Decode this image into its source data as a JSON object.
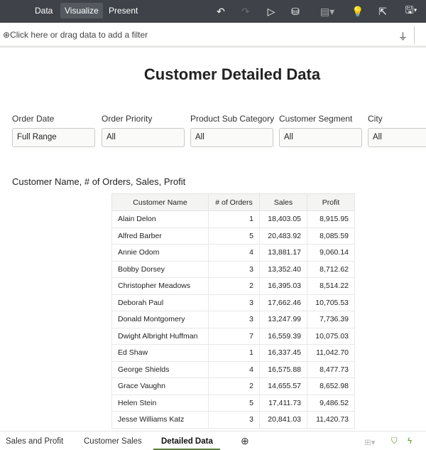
{
  "toolbar": {
    "tabs": [
      "Data",
      "Visualize",
      "Present"
    ],
    "active_tab": "Visualize"
  },
  "filter_bar": {
    "placeholder": "Click here or drag data to add a filter"
  },
  "page_title": "Customer Detailed Data",
  "filters": [
    {
      "label": "Order Date",
      "value": "Full Range"
    },
    {
      "label": "Order Priority",
      "value": "All"
    },
    {
      "label": "Product Sub Category",
      "value": "All"
    },
    {
      "label": "Customer Segment",
      "value": "All"
    },
    {
      "label": "City",
      "value": "All"
    }
  ],
  "table": {
    "title": "Customer Name, # of Orders, Sales, Profit",
    "columns": [
      "Customer Name",
      "# of Orders",
      "Sales",
      "Profit"
    ],
    "rows": [
      [
        "Alain Delon",
        "1",
        "18,403.05",
        "8,915.95"
      ],
      [
        "Alfred Barber",
        "5",
        "20,483.92",
        "8,085.59"
      ],
      [
        "Annie Odom",
        "4",
        "13,881.17",
        "9,060.14"
      ],
      [
        "Bobby Dorsey",
        "3",
        "13,352.40",
        "8,712.62"
      ],
      [
        "Christopher Meadows",
        "2",
        "16,395.03",
        "8,514.22"
      ],
      [
        "Deborah Paul",
        "3",
        "17,662.46",
        "10,705.53"
      ],
      [
        "Donald Montgomery",
        "3",
        "13,247.99",
        "7,736.39"
      ],
      [
        "Dwight Albright Huffman",
        "7",
        "16,559.39",
        "10,075.03"
      ],
      [
        "Ed Shaw",
        "1",
        "16,337.45",
        "11,042.70"
      ],
      [
        "George Shields",
        "4",
        "16,575.88",
        "8,477.73"
      ],
      [
        "Grace Vaughn",
        "2",
        "14,655.57",
        "8,652.98"
      ],
      [
        "Helen Stein",
        "5",
        "17,411.73",
        "9,486.52"
      ],
      [
        "Jesse Williams Katz",
        "3",
        "20,841.03",
        "11,420.73"
      ]
    ]
  },
  "canvas_tabs": [
    "Sales and Profit",
    "Customer Sales",
    "Detailed Data"
  ],
  "active_canvas": "Detailed Data",
  "colors": {
    "toolbar_bg": "#3f4349",
    "accent_green": "#5b7f3a",
    "insight_bulb": "#e8b931"
  }
}
